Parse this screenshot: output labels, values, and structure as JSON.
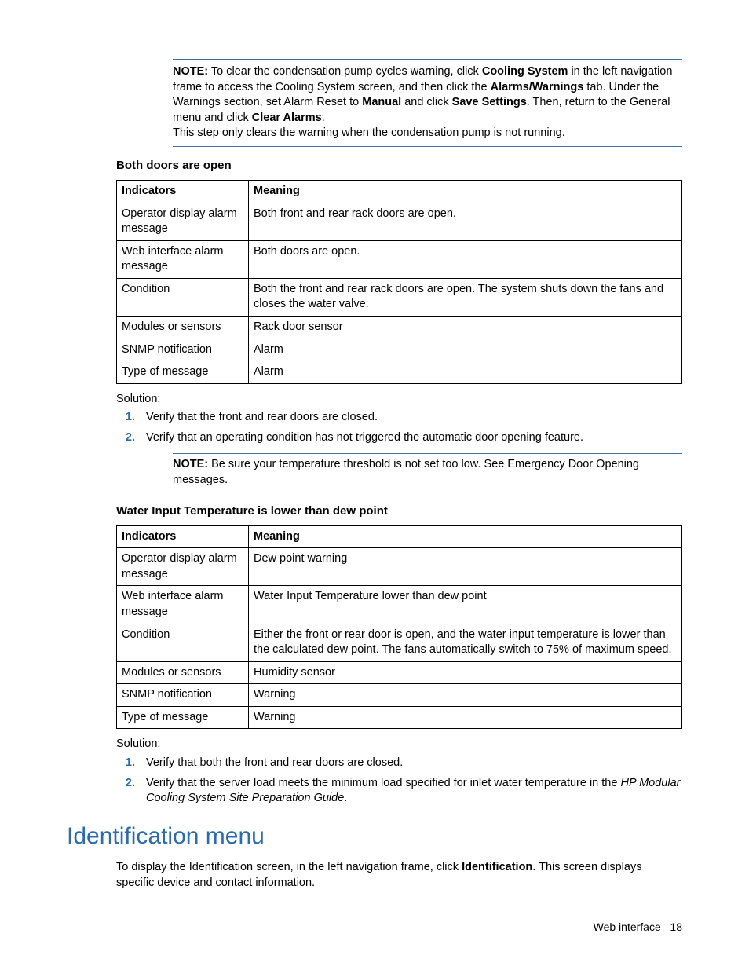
{
  "note1": {
    "label": "NOTE:",
    "text_a": "To clear the condensation pump cycles warning, click ",
    "bold_a": "Cooling System",
    "text_b": " in the left navigation frame to access the Cooling System screen, and then click the ",
    "bold_b": "Alarms/Warnings",
    "text_c": " tab. Under the Warnings section, set Alarm Reset to ",
    "bold_c": "Manual",
    "text_d": " and click ",
    "bold_d": "Save Settings",
    "text_e": ". Then, return to the General menu and click ",
    "bold_e": "Clear Alarms",
    "text_f": ".",
    "line2": "This step only clears the warning when the condensation pump is not running."
  },
  "section1": {
    "title": "Both doors are open",
    "headers": {
      "c1": "Indicators",
      "c2": "Meaning"
    },
    "rows": [
      {
        "c1": "Operator display alarm message",
        "c2": "Both front and rear rack doors are open."
      },
      {
        "c1": "Web interface alarm message",
        "c2": "Both doors are open."
      },
      {
        "c1": "Condition",
        "c2": "Both the front and rear rack doors are open. The system shuts down the fans and closes the water valve."
      },
      {
        "c1": "Modules or sensors",
        "c2": "Rack door sensor"
      },
      {
        "c1": "SNMP notification",
        "c2": "Alarm"
      },
      {
        "c1": "Type of message",
        "c2": "Alarm"
      }
    ],
    "solution_label": "Solution:",
    "steps": [
      "Verify that the front and rear doors are closed.",
      "Verify that an operating condition has not triggered the automatic door opening feature."
    ],
    "note": {
      "label": "NOTE:",
      "text": "Be sure your temperature threshold is not set too low. See Emergency Door Opening messages."
    }
  },
  "section2": {
    "title": "Water Input Temperature is lower than dew point",
    "headers": {
      "c1": "Indicators",
      "c2": "Meaning"
    },
    "rows": [
      {
        "c1": "Operator display alarm message",
        "c2": "Dew point warning"
      },
      {
        "c1": "Web interface alarm message",
        "c2": "Water Input Temperature lower than dew point"
      },
      {
        "c1": "Condition",
        "c2": "Either the front or rear door is open, and the water input temperature is lower than the calculated dew point. The fans automatically switch to 75% of maximum speed."
      },
      {
        "c1": "Modules or sensors",
        "c2": "Humidity sensor"
      },
      {
        "c1": "SNMP notification",
        "c2": "Warning"
      },
      {
        "c1": "Type of message",
        "c2": "Warning"
      }
    ],
    "solution_label": "Solution:",
    "steps": {
      "s1": "Verify that both the front and rear doors are closed.",
      "s2_a": "Verify that the server load meets the minimum load specified for inlet water temperature in the ",
      "s2_italic": "HP Modular Cooling System Site Preparation Guide",
      "s2_b": "."
    }
  },
  "heading": "Identification menu",
  "body": {
    "text_a": "To display the Identification screen, in the left navigation frame, click ",
    "bold_a": "Identification",
    "text_b": ". This screen displays specific device and contact information."
  },
  "footer": {
    "label": "Web interface",
    "page": "18"
  }
}
